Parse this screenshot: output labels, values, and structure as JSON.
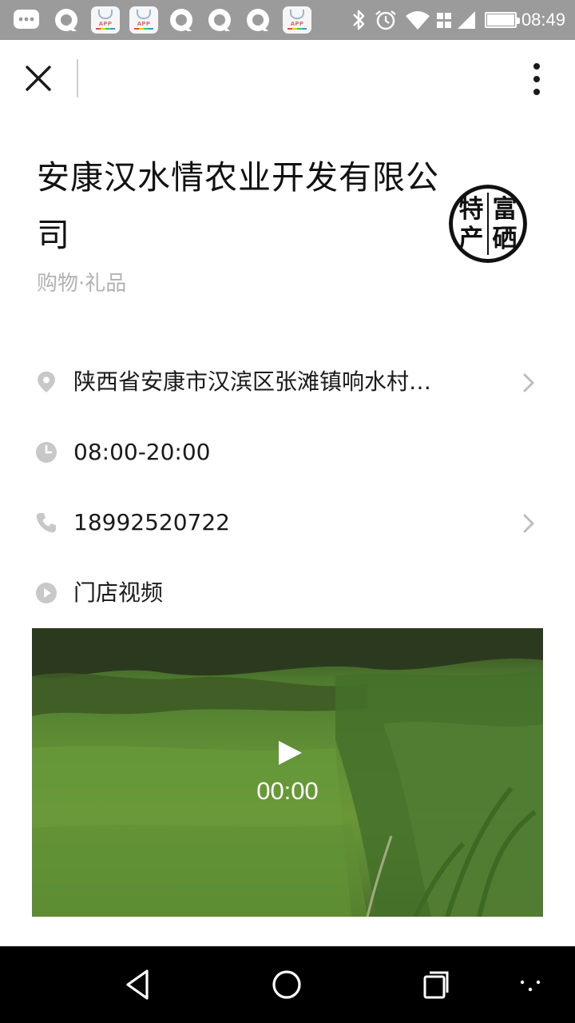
{
  "status_bar": {
    "time": "08:49",
    "app_badge_label": "APP",
    "icons": [
      "message-icon",
      "browser-icon",
      "app-store-icon",
      "app-store-icon",
      "browser-icon",
      "browser-icon",
      "browser-icon",
      "app-store-icon",
      "bluetooth-icon",
      "alarm-icon",
      "wifi-icon",
      "signal-3g-icon",
      "signal-bars-icon",
      "battery-icon"
    ]
  },
  "top_bar": {
    "close_icon": "close-icon",
    "more_icon": "more-vertical-icon"
  },
  "store": {
    "name": "安康汉水情农业开发有限公司",
    "category": "购物·礼品",
    "logo_chars": [
      "特",
      "产",
      "富",
      "硒"
    ]
  },
  "info": {
    "address": "陕西省安康市汉滨区张滩镇响水村…",
    "hours": "08:00-20:00",
    "phone": "18992520722",
    "video_label": "门店视频"
  },
  "video": {
    "time": "00:00"
  },
  "colors": {
    "status_bar": "#9b9b9b",
    "icon_gray": "#c8c8c8",
    "category_text": "#b2b2b2",
    "nav_bar": "#000000"
  }
}
